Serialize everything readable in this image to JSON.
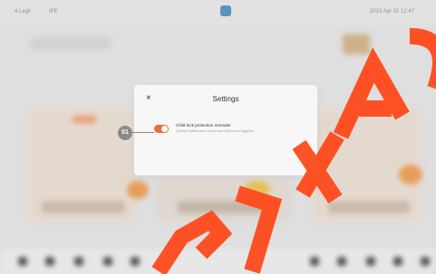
{
  "status_bar": {
    "left": [
      "4 Legit",
      "IPE"
    ],
    "right": "2023 Apr 01 12:47"
  },
  "dialog": {
    "title": "Settings",
    "close_glyph": "×",
    "setting": {
      "label": "Child lock protection reminder",
      "description": "Quickly notifies driver when rear child lock is triggered",
      "enabled": true
    }
  },
  "callout": {
    "number": "01"
  },
  "watermark": {
    "text": "PATRAXA"
  },
  "colors": {
    "accent": "#f06a35",
    "dialog_bg": "#f7f7f7",
    "callout": "#8a8a8a",
    "watermark": "#ff4a1c"
  }
}
